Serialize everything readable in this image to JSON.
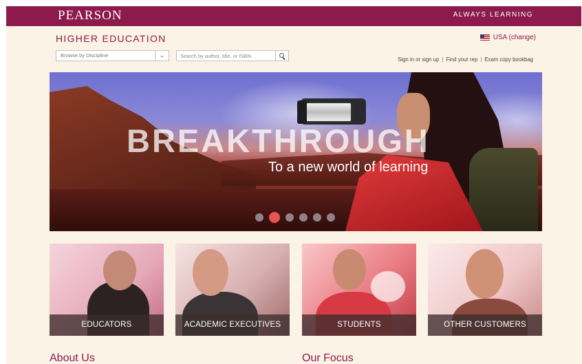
{
  "header": {
    "logo": "PEARSON",
    "tagline": "ALWAYS LEARNING",
    "brand_color": "#8c1a4c"
  },
  "subheader": {
    "title": "HIGHER EDUCATION",
    "country_label": "USA (change)",
    "country_icon": "us-flag-icon"
  },
  "browse": {
    "selected": "Browse by Discipline",
    "dropdown_icon": "chevron-down-icon"
  },
  "search": {
    "placeholder": "Search by author, title, or ISBN",
    "button_icon": "search-icon"
  },
  "toplinks": {
    "signin": "Sign in or sign up",
    "find_rep": "Find your rep",
    "bookbag": "Exam copy bookbag",
    "separator": "|"
  },
  "hero": {
    "title": "BREAKTHROUGH",
    "subtitle": "To a new world of learning",
    "slide_count": 6,
    "active_slide": 2,
    "active_color": "#e8544f"
  },
  "tiles": [
    {
      "label": "EDUCATORS"
    },
    {
      "label": "ACADEMIC EXECUTIVES"
    },
    {
      "label": "STUDENTS"
    },
    {
      "label": "OTHER CUSTOMERS"
    }
  ],
  "sections": {
    "about": "About Us",
    "focus": "Our Focus"
  }
}
